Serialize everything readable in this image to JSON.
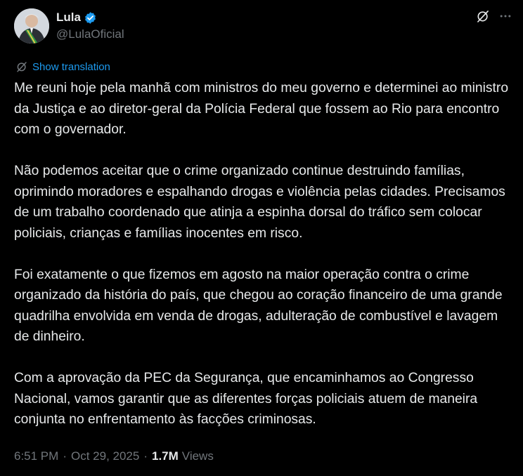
{
  "author": {
    "display_name": "Lula",
    "handle": "@LulaOficial",
    "verified": true
  },
  "icons": {
    "verified_color": "#1d9bf0",
    "grok": "grok-icon",
    "more": "more-icon",
    "translate": "translate-icon"
  },
  "translation": {
    "label": "Show translation"
  },
  "post": {
    "paragraphs": [
      "Me reuni hoje pela manhã com ministros do meu governo e determinei ao ministro da Justiça e ao diretor-geral da Polícia Federal que fossem ao Rio para encontro com o governador.",
      "Não podemos aceitar que o crime organizado continue destruindo famílias, oprimindo moradores e espalhando drogas e violência pelas cidades. Precisamos de um trabalho coordenado que atinja a espinha dorsal do tráfico sem colocar policiais, crianças e famílias inocentes em risco.",
      "Foi exatamente o que fizemos em agosto na maior operação contra o crime organizado da história do país, que chegou ao coração financeiro de uma grande quadrilha envolvida em venda de drogas, adulteração de combustível e lavagem de dinheiro.",
      "Com a aprovação da PEC da Segurança, que encaminhamos ao Congresso Nacional, vamos garantir que as diferentes forças policiais atuem de maneira conjunta no enfrentamento às facções criminosas."
    ]
  },
  "meta": {
    "time": "6:51 PM",
    "date": "Oct 29, 2025",
    "separator": "·",
    "views_count": "1.7M",
    "views_label": "Views"
  }
}
